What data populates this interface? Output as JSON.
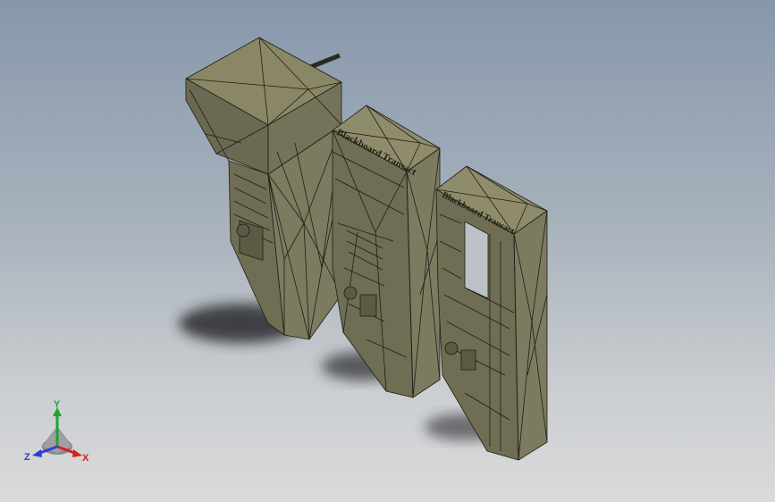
{
  "viewport": {
    "background_top": "#8797ab",
    "background_bottom": "#d9dadb",
    "model_fill": "#7c7a5f",
    "model_fill_light": "#9a9777",
    "model_fill_dark": "#4e4c3a",
    "mesh_stroke": "#1e1e16",
    "shadow_color": "#262629"
  },
  "models": [
    {
      "name": "kiosk-1",
      "engraving": ""
    },
    {
      "name": "kiosk-2",
      "engraving": "Blackboard Transact"
    },
    {
      "name": "kiosk-3",
      "engraving": "Blackboard Transact"
    }
  ],
  "triad": {
    "x_label": "X",
    "y_label": "Y",
    "z_label": "Z",
    "x_color": "#d42020",
    "y_color": "#1fa52a",
    "z_color": "#2a3fd6"
  }
}
